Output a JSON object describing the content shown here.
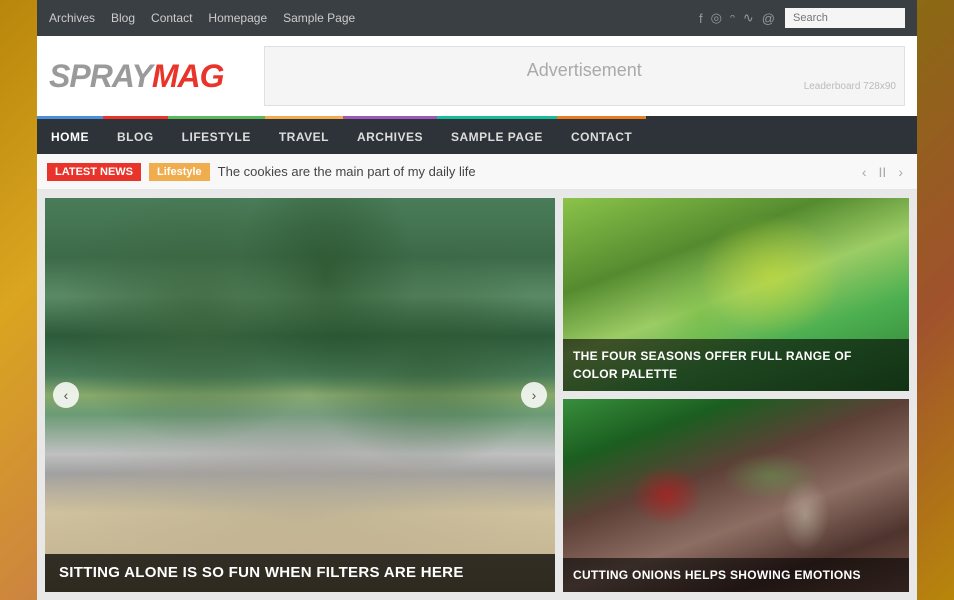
{
  "background": {
    "color": "#b8860b"
  },
  "topNav": {
    "links": [
      {
        "label": "Archives",
        "id": "archives"
      },
      {
        "label": "Blog",
        "id": "blog"
      },
      {
        "label": "Contact",
        "id": "contact"
      },
      {
        "label": "Homepage",
        "id": "homepage"
      },
      {
        "label": "Sample Page",
        "id": "sample-page"
      }
    ],
    "socialIcons": [
      {
        "name": "facebook-icon",
        "symbol": "f"
      },
      {
        "name": "pinterest-icon",
        "symbol": "p"
      },
      {
        "name": "twitter-icon",
        "symbol": "t"
      },
      {
        "name": "rss-icon",
        "symbol": "r"
      },
      {
        "name": "email-icon",
        "symbol": "@"
      }
    ],
    "search": {
      "placeholder": "Search"
    }
  },
  "header": {
    "logo": {
      "spray": "SPRAY",
      "mag": "MAG"
    },
    "ad": {
      "label": "Advertisement",
      "subLabel": "Leaderboard 728x90"
    }
  },
  "mainNav": {
    "items": [
      {
        "label": "HOME",
        "id": "home",
        "colorClass": "home"
      },
      {
        "label": "BLOG",
        "id": "blog",
        "colorClass": "blog"
      },
      {
        "label": "LIFESTYLE",
        "id": "lifestyle",
        "colorClass": "lifestyle"
      },
      {
        "label": "TRAVEL",
        "id": "travel",
        "colorClass": "travel"
      },
      {
        "label": "ARCHIVES",
        "id": "archives",
        "colorClass": "archives"
      },
      {
        "label": "SAMPLE PAGE",
        "id": "sample-page",
        "colorClass": "sample-page"
      },
      {
        "label": "CONTACT",
        "id": "contact",
        "colorClass": "contact"
      }
    ]
  },
  "latestNews": {
    "badgeLabel": "LATEST NEWS",
    "categoryLabel": "Lifestyle",
    "headline": "The cookies are the main part of my daily life",
    "prevLabel": "‹",
    "pauseLabel": "II",
    "nextLabel": "›"
  },
  "featured": {
    "caption": "SITTING ALONE IS SO FUN WHEN FILTERS ARE HERE",
    "prevBtn": "‹",
    "nextBtn": "›"
  },
  "sideArticles": [
    {
      "caption": "THE FOUR SEASONS OFFER FULL RANGE OF COLOR PALETTE"
    },
    {
      "caption": "CUTTING ONIONS HELPS SHOWING EMOTIONS"
    }
  ]
}
